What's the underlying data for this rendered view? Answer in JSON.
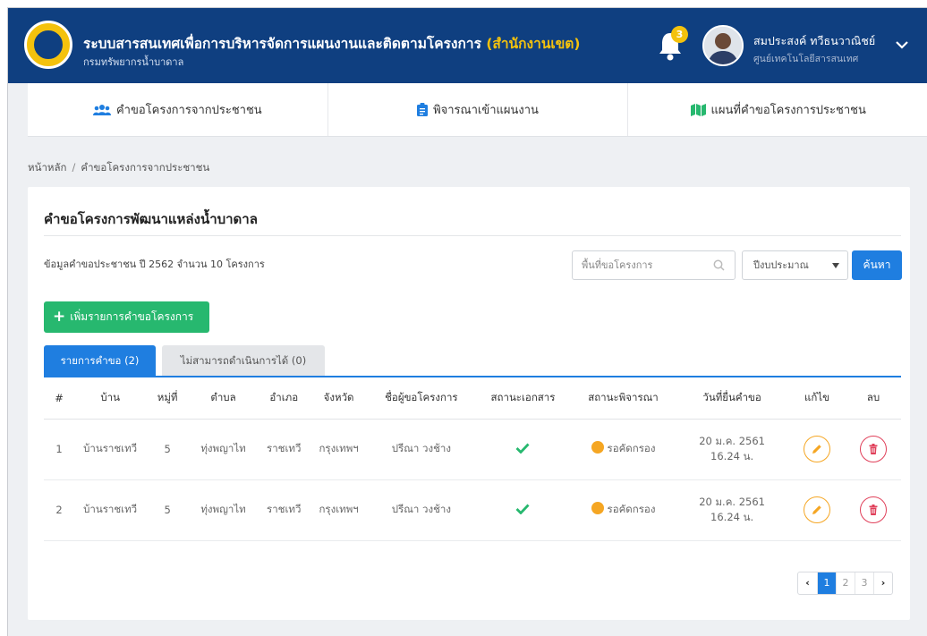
{
  "header": {
    "title_main": "ระบบสารสนเทศเพื่อการบริหารจัดการแผนงานและติดตามโครงการ",
    "title_accent": "(สำนักงานเขต)",
    "subtitle": "กรมทรัพยากรน้ำบาดาล",
    "notification_count": "3",
    "user_name": "สมประสงค์ ทวีธนวาณิชย์",
    "user_org": "ศูนย์เทคโนโลยีสารสนเทศ"
  },
  "nav": {
    "tabs": [
      {
        "label": "คำขอโครงการจากประชาชน",
        "icon": "users-icon"
      },
      {
        "label": "พิจารณาเข้าแผนงาน",
        "icon": "clipboard-icon"
      },
      {
        "label": "แผนที่คำขอโครงการประชาชน",
        "icon": "map-icon"
      }
    ]
  },
  "breadcrumb": {
    "home": "หน้าหลัก",
    "separator": "/",
    "current": "คำขอโครงการจากประชาชน"
  },
  "card": {
    "title": "คำขอโครงการพัฒนาแหล่งน้ำบาดาล",
    "summary": "ข้อมูลคำขอประชาชน ปี 2562 จำนวน 10 โครงการ",
    "search_placeholder": "พื้นที่ขอโครงการ",
    "year_select": "ปีงบประมาณ",
    "search_button": "ค้นหา",
    "add_button": "เพิ่มรายการคำขอโครงการ"
  },
  "tabs": {
    "active": "รายการคำขอ (2)",
    "inactive": "ไม่สามารถดำเนินการได้ (0)"
  },
  "table": {
    "headers": [
      "#",
      "บ้าน",
      "หมู่ที่",
      "ตำบล",
      "อำเภอ",
      "จังหวัด",
      "ชื่อผู้ขอโครงการ",
      "สถานะเอกสาร",
      "สถานะพิจารณา",
      "วันที่ยื่นคำขอ",
      "แก้ไข",
      "ลบ"
    ],
    "rows": [
      {
        "no": "1",
        "village": "บ้านราชเทวี",
        "moo": "5",
        "tambon": "ทุ่งพญาไท",
        "amphoe": "ราชเทวี",
        "province": "กรุงเทพฯ",
        "requester": "ปรีณา วงช้าง",
        "status": "รอคัดกรอง",
        "date": "20 ม.ค. 2561",
        "time": "16.24 น."
      },
      {
        "no": "2",
        "village": "บ้านราชเทวี",
        "moo": "5",
        "tambon": "ทุ่งพญาไท",
        "amphoe": "ราชเทวี",
        "province": "กรุงเทพฯ",
        "requester": "ปรีณา วงช้าง",
        "status": "รอคัดกรอง",
        "date": "20 ม.ค. 2561",
        "time": "16.24 น."
      }
    ]
  },
  "pagination": {
    "pages": [
      "1",
      "2",
      "3"
    ],
    "current": "1"
  },
  "colors": {
    "header_bg": "#0f3f80",
    "accent_yellow": "#f4c20d",
    "primary": "#1f7ee0",
    "success": "#27b86f",
    "warning": "#f5a623",
    "danger": "#e0405a"
  }
}
